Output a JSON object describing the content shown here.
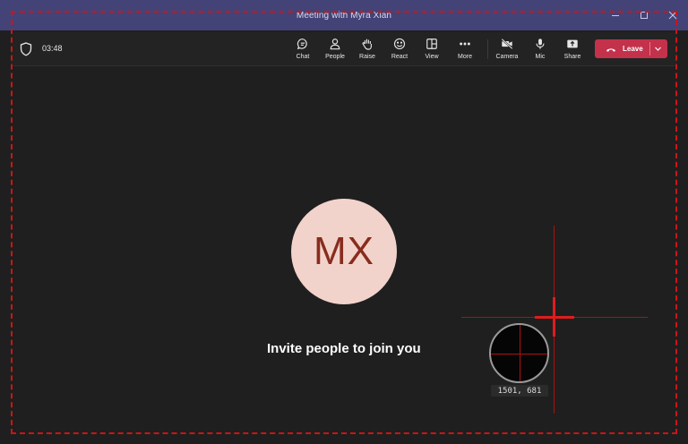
{
  "window": {
    "title": "Meeting with Myra Xian"
  },
  "toolbar": {
    "timer": "03:48",
    "tools": [
      {
        "id": "chat",
        "label": "Chat",
        "icon": "chat-icon"
      },
      {
        "id": "people",
        "label": "People",
        "icon": "people-icon"
      },
      {
        "id": "raise",
        "label": "Raise",
        "icon": "hand-icon"
      },
      {
        "id": "react",
        "label": "React",
        "icon": "smiley-icon"
      },
      {
        "id": "view",
        "label": "View",
        "icon": "layout-icon"
      },
      {
        "id": "more",
        "label": "More",
        "icon": "ellipsis-icon"
      },
      {
        "id": "camera",
        "label": "Camera",
        "icon": "camera-off-icon"
      },
      {
        "id": "mic",
        "label": "Mic",
        "icon": "microphone-icon"
      },
      {
        "id": "share",
        "label": "Share",
        "icon": "share-icon"
      }
    ],
    "leave_label": "Leave"
  },
  "stage": {
    "avatar_initials": "MX",
    "invite_text": "Invite people to join you"
  },
  "overlay": {
    "coords": "1501, 681"
  },
  "colors": {
    "titlebar": "#434378",
    "background": "#1f1f1f",
    "leave": "#c4314b",
    "avatar_bg": "#f2d3cb",
    "avatar_text": "#882c1e",
    "frame": "#cc1515"
  }
}
